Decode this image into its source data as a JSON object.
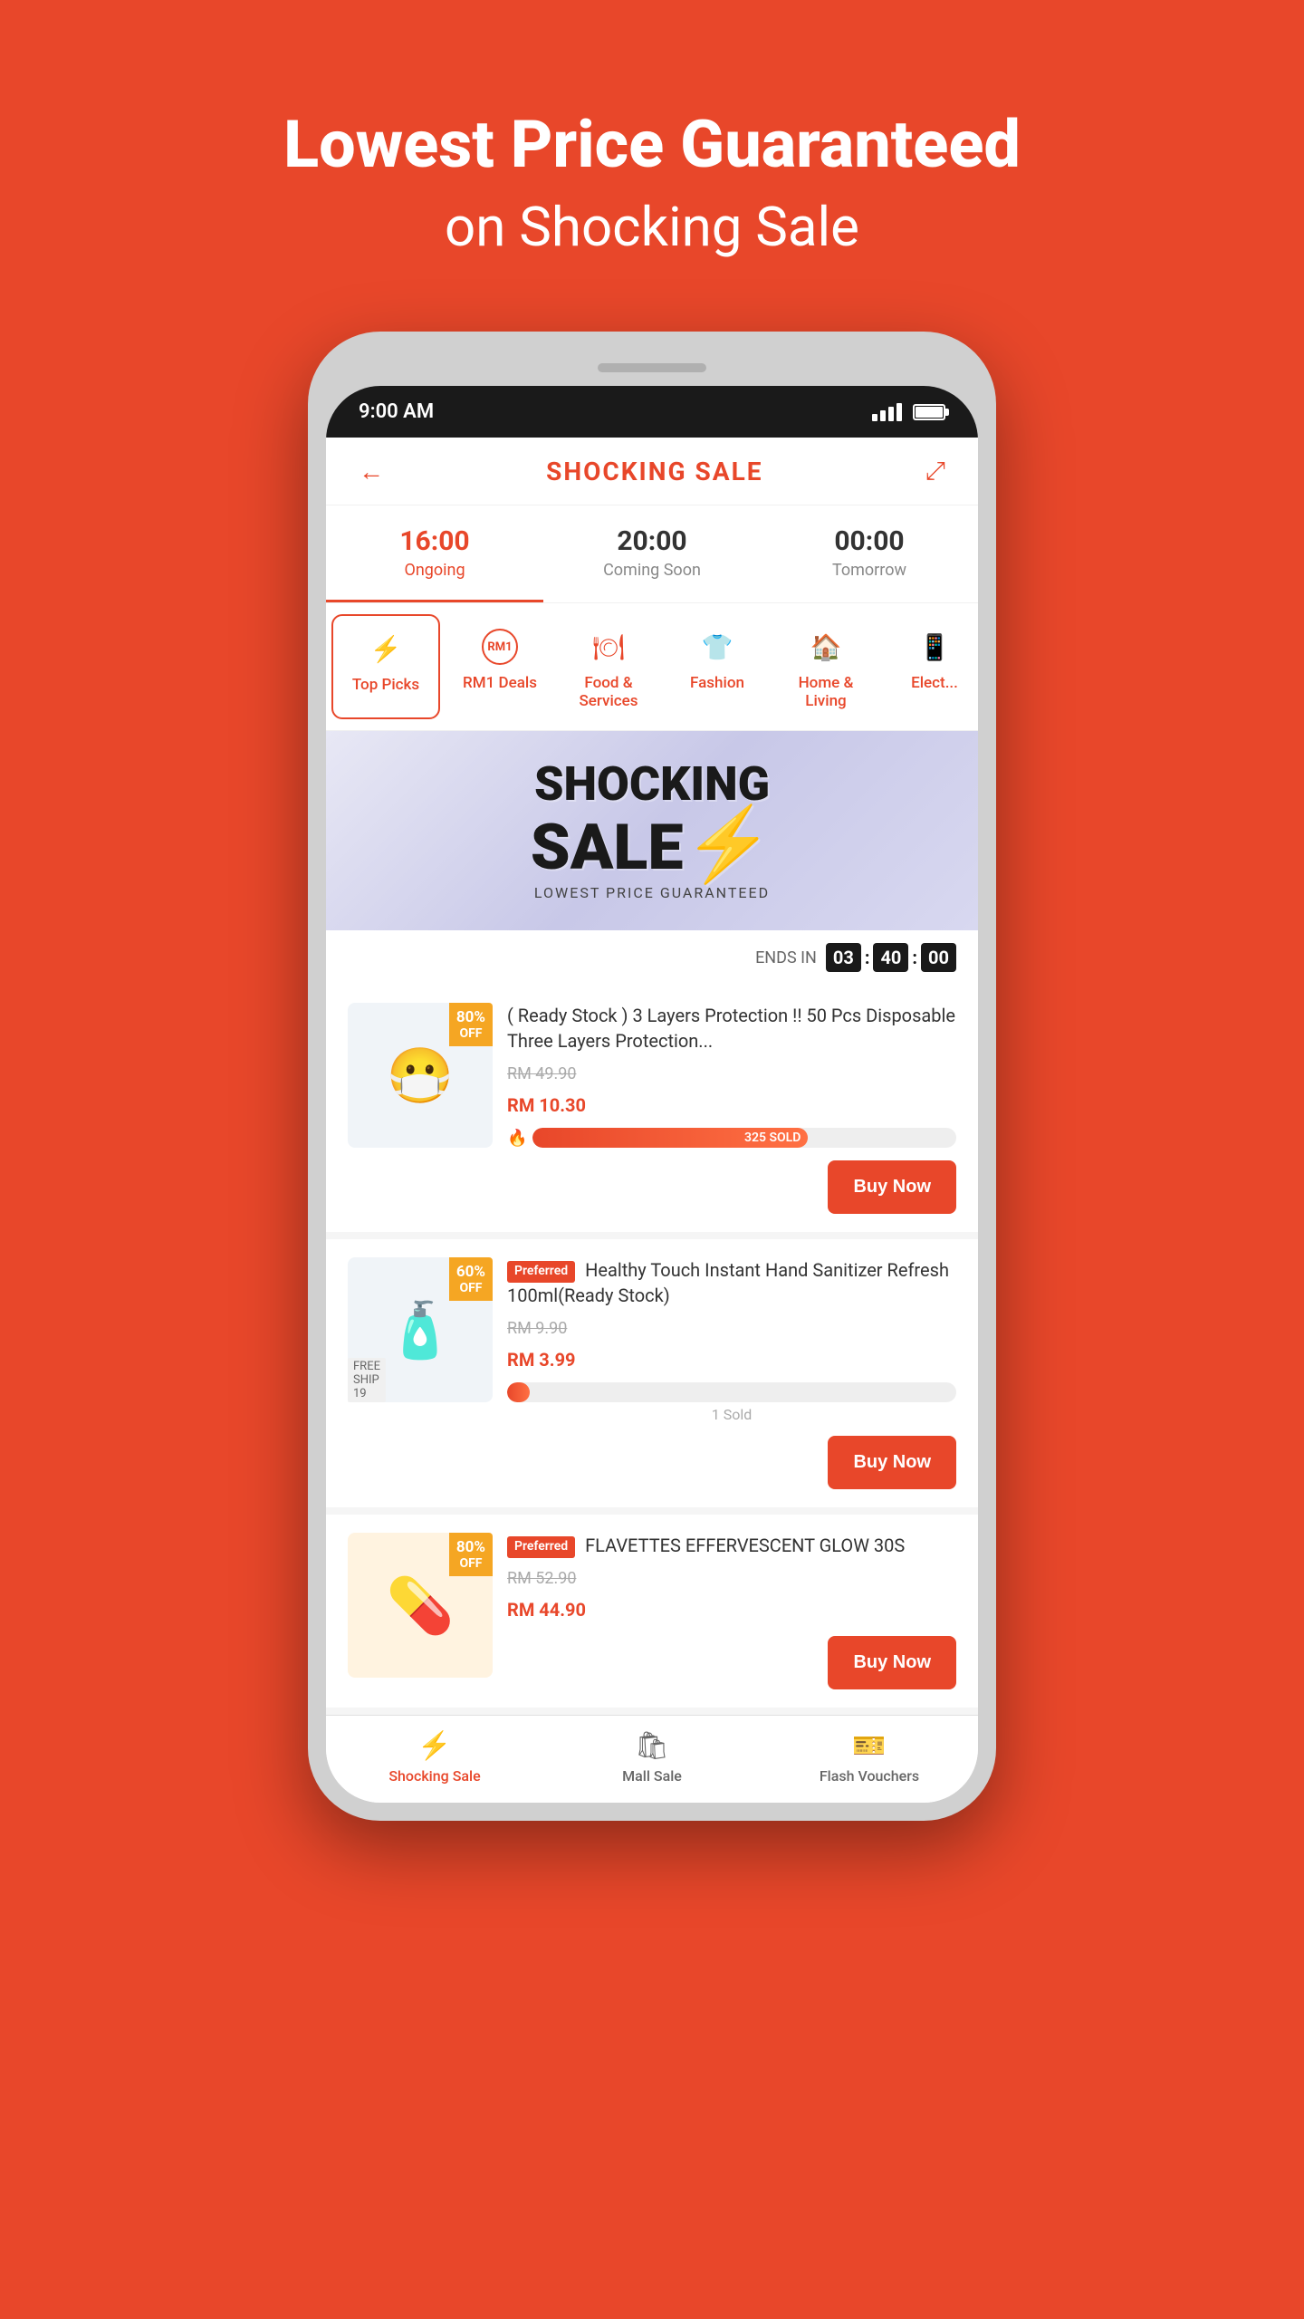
{
  "hero": {
    "line1": "Lowest Price Guaranteed",
    "line2": "on Shocking Sale"
  },
  "status_bar": {
    "time": "9:00 AM"
  },
  "header": {
    "title": "SHOCKING SALE",
    "back_label": "←",
    "share_label": "⤢"
  },
  "time_tabs": [
    {
      "time": "16:00",
      "label": "Ongoing",
      "active": true
    },
    {
      "time": "20:00",
      "label": "Coming Soon",
      "active": false
    },
    {
      "time": "00:00",
      "label": "Tomorrow",
      "active": false
    }
  ],
  "category_tabs": [
    {
      "icon": "⚡",
      "label": "Top Picks",
      "active": true
    },
    {
      "icon": "RM1",
      "label": "RM1 Deals",
      "active": false,
      "type": "badge"
    },
    {
      "icon": "🍽",
      "label": "Food &\nServices",
      "active": false
    },
    {
      "icon": "👕",
      "label": "Fashion",
      "active": false
    },
    {
      "icon": "🏠",
      "label": "Home &\nLiving",
      "active": false
    },
    {
      "icon": "⚡",
      "label": "Elect...",
      "active": false
    }
  ],
  "banner": {
    "line1": "SHOCKING",
    "line2": "SALE",
    "lightning": "⚡",
    "subtitle": "LOWEST PRICE GUARANTEED"
  },
  "countdown": {
    "ends_in": "ENDS IN",
    "hours": "03",
    "minutes": "40",
    "seconds": "00"
  },
  "products": [
    {
      "id": 1,
      "discount": "80%",
      "off_label": "OFF",
      "icon": "😷",
      "name": "( Ready Stock ) 3 Layers Protection !! 50 Pcs Disposable Three Layers Protection...",
      "original_price": "RM 49.90",
      "sale_price": "RM 10.30",
      "sale_prefix": "RM",
      "sale_amount": "10.30",
      "buy_label": "Buy Now",
      "progress": 65,
      "sold": "325 SOLD",
      "preferred": false,
      "free_ship": null
    },
    {
      "id": 2,
      "discount": "60%",
      "off_label": "OFF",
      "icon": "🧴",
      "name": "Healthy Touch Instant Hand Sanitizer Refresh 100ml(Ready Stock)",
      "original_price": "RM 9.90",
      "sale_price": "RM 3.99",
      "sale_prefix": "RM",
      "sale_amount": "3.99",
      "buy_label": "Buy Now",
      "progress": 5,
      "sold": "1 Sold",
      "preferred": true,
      "free_ship": "19"
    },
    {
      "id": 3,
      "discount": "80%",
      "off_label": "OFF",
      "icon": "💊",
      "name": "FLAVETTES EFFERVESCENT GLOW 30S",
      "original_price": "RM 52.90",
      "sale_price": "RM 44.90",
      "sale_prefix": "RM",
      "sale_amount": "44.90",
      "buy_label": "Buy Now",
      "progress": 0,
      "sold": "",
      "preferred": true,
      "free_ship": null
    }
  ],
  "bottom_nav": [
    {
      "icon": "⚡",
      "label": "Shocking Sale",
      "active": true
    },
    {
      "icon": "🛍",
      "label": "Mall Sale",
      "active": false
    },
    {
      "icon": "🎫",
      "label": "Flash Vouchers",
      "active": false
    }
  ]
}
